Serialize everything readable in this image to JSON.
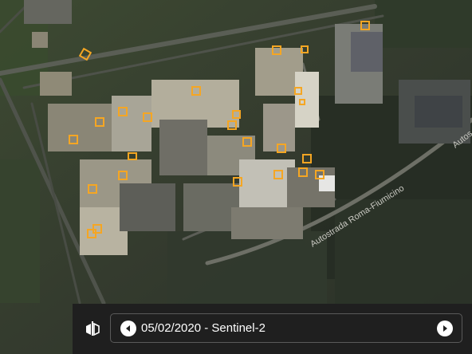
{
  "map": {
    "road_labels": [
      "Autostrada Roma-Fiumicino",
      "Autos"
    ],
    "marker_color": "#f5a623",
    "marker_count": 30
  },
  "toolbar": {
    "compare_icon": "compare-split-icon",
    "prev_icon": "chevron-left-icon",
    "next_icon": "chevron-right-icon",
    "date_label": "05/02/2020 - Sentinel-2"
  }
}
